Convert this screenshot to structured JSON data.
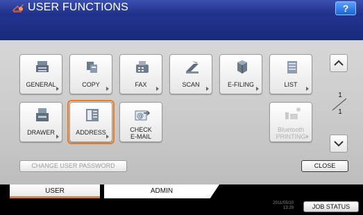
{
  "header": {
    "title": "USER FUNCTIONS",
    "help_label": "?"
  },
  "grid": {
    "row1": [
      {
        "label": "GENERAL",
        "icon": "general-icon"
      },
      {
        "label": "COPY",
        "icon": "copy-icon"
      },
      {
        "label": "FAX",
        "icon": "fax-icon"
      },
      {
        "label": "SCAN",
        "icon": "scan-icon"
      },
      {
        "label": "E-FILING",
        "icon": "efiling-icon"
      },
      {
        "label": "LIST",
        "icon": "list-icon"
      }
    ],
    "row2": [
      {
        "label": "DRAWER",
        "icon": "drawer-icon"
      },
      {
        "label": "ADDRESS",
        "icon": "address-book-icon",
        "selected": true
      },
      {
        "label_line1": "CHECK",
        "label_line2": "E-MAIL",
        "icon": "check-email-icon"
      },
      {
        "label_line1": "Bluetooth",
        "label_line2": "PRINTING",
        "icon": "bluetooth-printing-icon",
        "disabled": true
      }
    ]
  },
  "pagination": {
    "current": "1",
    "total": "1"
  },
  "bottom": {
    "change_password_label": "CHANGE USER PASSWORD",
    "close_label": "CLOSE"
  },
  "tabs": [
    {
      "label": "USER",
      "active": true
    },
    {
      "label": "ADMIN",
      "active": false
    }
  ],
  "status": {
    "date": "2011/05/10",
    "time": "13:29",
    "job_status_label": "JOB STATUS"
  },
  "colors": {
    "title_bar": "#2a3d9a",
    "accent_orange": "#f07a1c",
    "panel": "#cfcfcf"
  }
}
